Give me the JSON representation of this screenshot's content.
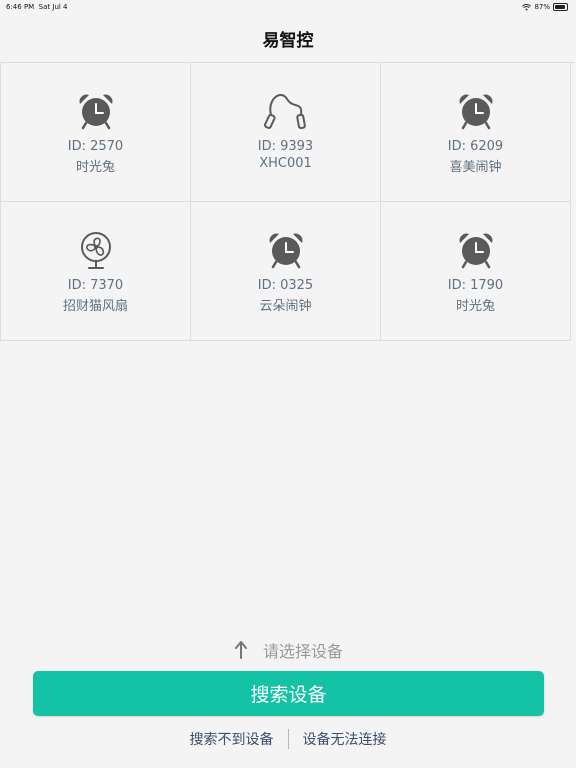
{
  "status_bar": {
    "time": "6:46 PM",
    "date": "Sat Jul 4",
    "battery": "87%",
    "battery_level": 0.87
  },
  "header": {
    "title": "易智控"
  },
  "devices": [
    {
      "id_text": "ID: 2570",
      "name": "时光兔",
      "icon": "alarm-clock-icon"
    },
    {
      "id_text": "ID: 9393",
      "name": "XHC001",
      "icon": "jump-rope-icon"
    },
    {
      "id_text": "ID: 6209",
      "name": "喜美闹钟",
      "icon": "alarm-clock-icon"
    },
    {
      "id_text": "ID: 7370",
      "name": "招财猫风扇",
      "icon": "fan-icon"
    },
    {
      "id_text": "ID: 0325",
      "name": "云朵闹钟",
      "icon": "alarm-clock-icon"
    },
    {
      "id_text": "ID: 1790",
      "name": "时光兔",
      "icon": "alarm-clock-icon"
    }
  ],
  "footer": {
    "hint": "请选择设备",
    "search_button": "搜索设备",
    "link_not_found": "搜索不到设备",
    "link_cannot_connect": "设备无法连接"
  },
  "colors": {
    "accent": "#14c2a6",
    "icon": "#5a5a5a",
    "text_secondary": "#607080",
    "link": "#3b4e6e"
  }
}
